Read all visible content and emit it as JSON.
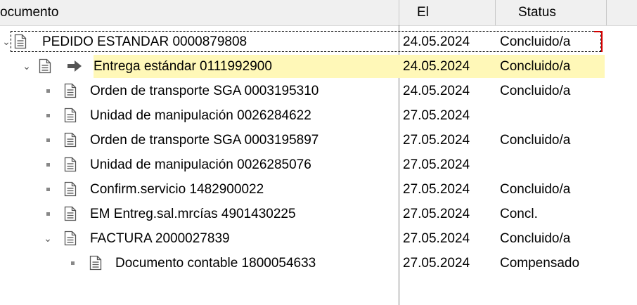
{
  "header": {
    "col_document": "ocumento",
    "col_date": "El",
    "col_status": "Status"
  },
  "rows": [
    {
      "label": "PEDIDO ESTANDAR 0000879808",
      "date": "24.05.2024",
      "status": "Concluido/a"
    },
    {
      "label": "Entrega estándar 0111992900",
      "date": "24.05.2024",
      "status": "Concluido/a"
    },
    {
      "label": "Orden de transporte SGA 0003195310",
      "date": "24.05.2024",
      "status": "Concluido/a"
    },
    {
      "label": "Unidad de manipulación 0026284622",
      "date": "27.05.2024",
      "status": ""
    },
    {
      "label": "Orden de transporte SGA 0003195897",
      "date": "27.05.2024",
      "status": "Concluido/a"
    },
    {
      "label": "Unidad de manipulación 0026285076",
      "date": "27.05.2024",
      "status": ""
    },
    {
      "label": "Confirm.servicio 1482900022",
      "date": "27.05.2024",
      "status": "Concluido/a"
    },
    {
      "label": "EM Entreg.sal.mrcías 4901430225",
      "date": "27.05.2024",
      "status": "Concl."
    },
    {
      "label": "FACTURA 2000027839",
      "date": "27.05.2024",
      "status": "Concluido/a"
    },
    {
      "label": "Documento contable 1800054633",
      "date": "27.05.2024",
      "status": "Compensado"
    }
  ],
  "colors": {
    "highlight": "#fff8b8",
    "focus_outline": "#d40000"
  },
  "icons": {
    "document": "document-icon",
    "arrow": "arrow-right-icon",
    "expand": "chevron-down-icon"
  }
}
